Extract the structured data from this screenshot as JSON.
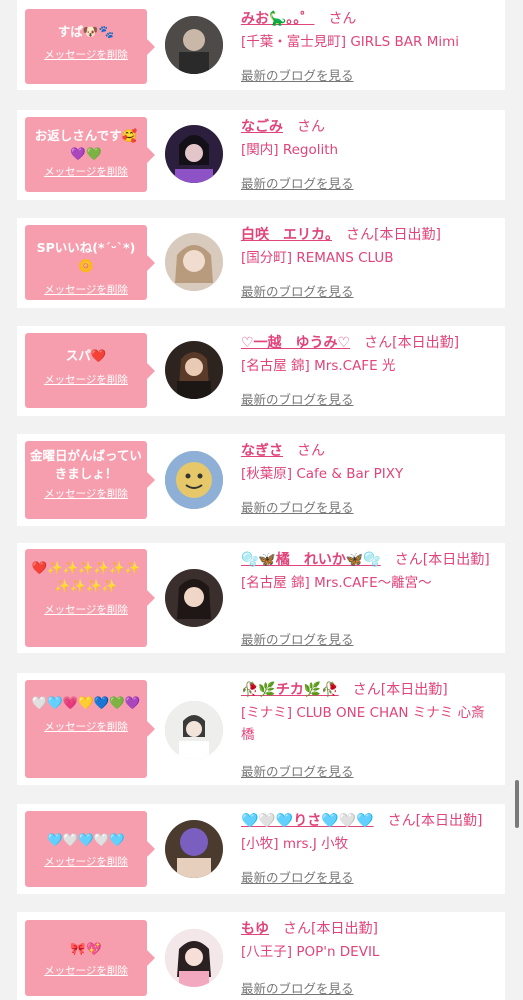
{
  "cards": [
    {
      "message": "すぱ🐶🐾",
      "delete_label": "メッセージを削除",
      "name": "みお🦕｡｡゜",
      "san": "さん",
      "attendance": "",
      "shop": "[千葉・富士見町] GIRLS BAR Mimi",
      "blog_label": "最新のブログを見る"
    },
    {
      "message": "お返しさんです🥰💜💚",
      "delete_label": "メッセージを削除",
      "name": "なごみ",
      "san": "さん",
      "attendance": "",
      "shop": "[関内] Regolith",
      "blog_label": "最新のブログを見る"
    },
    {
      "message": "SPいいね(*ˊᵕˋ*)🌼",
      "delete_label": "メッセージを削除",
      "name": "白咲　エリカ。",
      "san": "さん",
      "attendance": "[本日出勤]",
      "shop": "[国分町] REMANS CLUB",
      "blog_label": "最新のブログを見る"
    },
    {
      "message": "スパ❤️",
      "delete_label": "メッセージを削除",
      "name": "♡一越　ゆうみ♡",
      "san": "さん",
      "attendance": "[本日出勤]",
      "shop": "[名古屋 錦] Mrs.CAFE 光",
      "blog_label": "最新のブログを見る"
    },
    {
      "message": "金曜日がんばっていきましょ！",
      "delete_label": "メッセージを削除",
      "name": "なぎさ",
      "san": "さん",
      "attendance": "",
      "shop": "[秋葉原] Cafe & Bar PIXY",
      "blog_label": "最新のブログを見る"
    },
    {
      "message": "❤️✨✨✨✨✨✨✨✨✨✨",
      "delete_label": "メッセージを削除",
      "name": "🫧🦋橘　れいか🦋🫧",
      "san": "さん",
      "attendance": "[本日出勤]",
      "shop": "[名古屋 錦] Mrs.CAFE～離宮～",
      "blog_label": "最新のブログを見る"
    },
    {
      "message": "🤍🩵💗💛💙💚💜",
      "delete_label": "メッセージを削除",
      "name": "🥀🌿チカ🌿🥀",
      "san": "さん",
      "attendance": "[本日出勤]",
      "shop": "[ミナミ] CLUB ONE CHAN ミナミ 心斎橋",
      "blog_label": "最新のブログを見る"
    },
    {
      "message": "🩵🤍🩵🤍🩵",
      "delete_label": "メッセージを削除",
      "name": "🩵🤍🩵りさ🩵🤍🩵",
      "san": "さん",
      "attendance": "[本日出勤]",
      "shop": "[小牧] mrs.J 小牧",
      "blog_label": "最新のブログを見る"
    },
    {
      "message": "🎀💖",
      "delete_label": "メッセージを削除",
      "name": "もゆ",
      "san": "さん",
      "attendance": "[本日出勤]",
      "shop": "[八王子] POP'n DEVIL",
      "blog_label": "最新のブログを見る"
    }
  ]
}
